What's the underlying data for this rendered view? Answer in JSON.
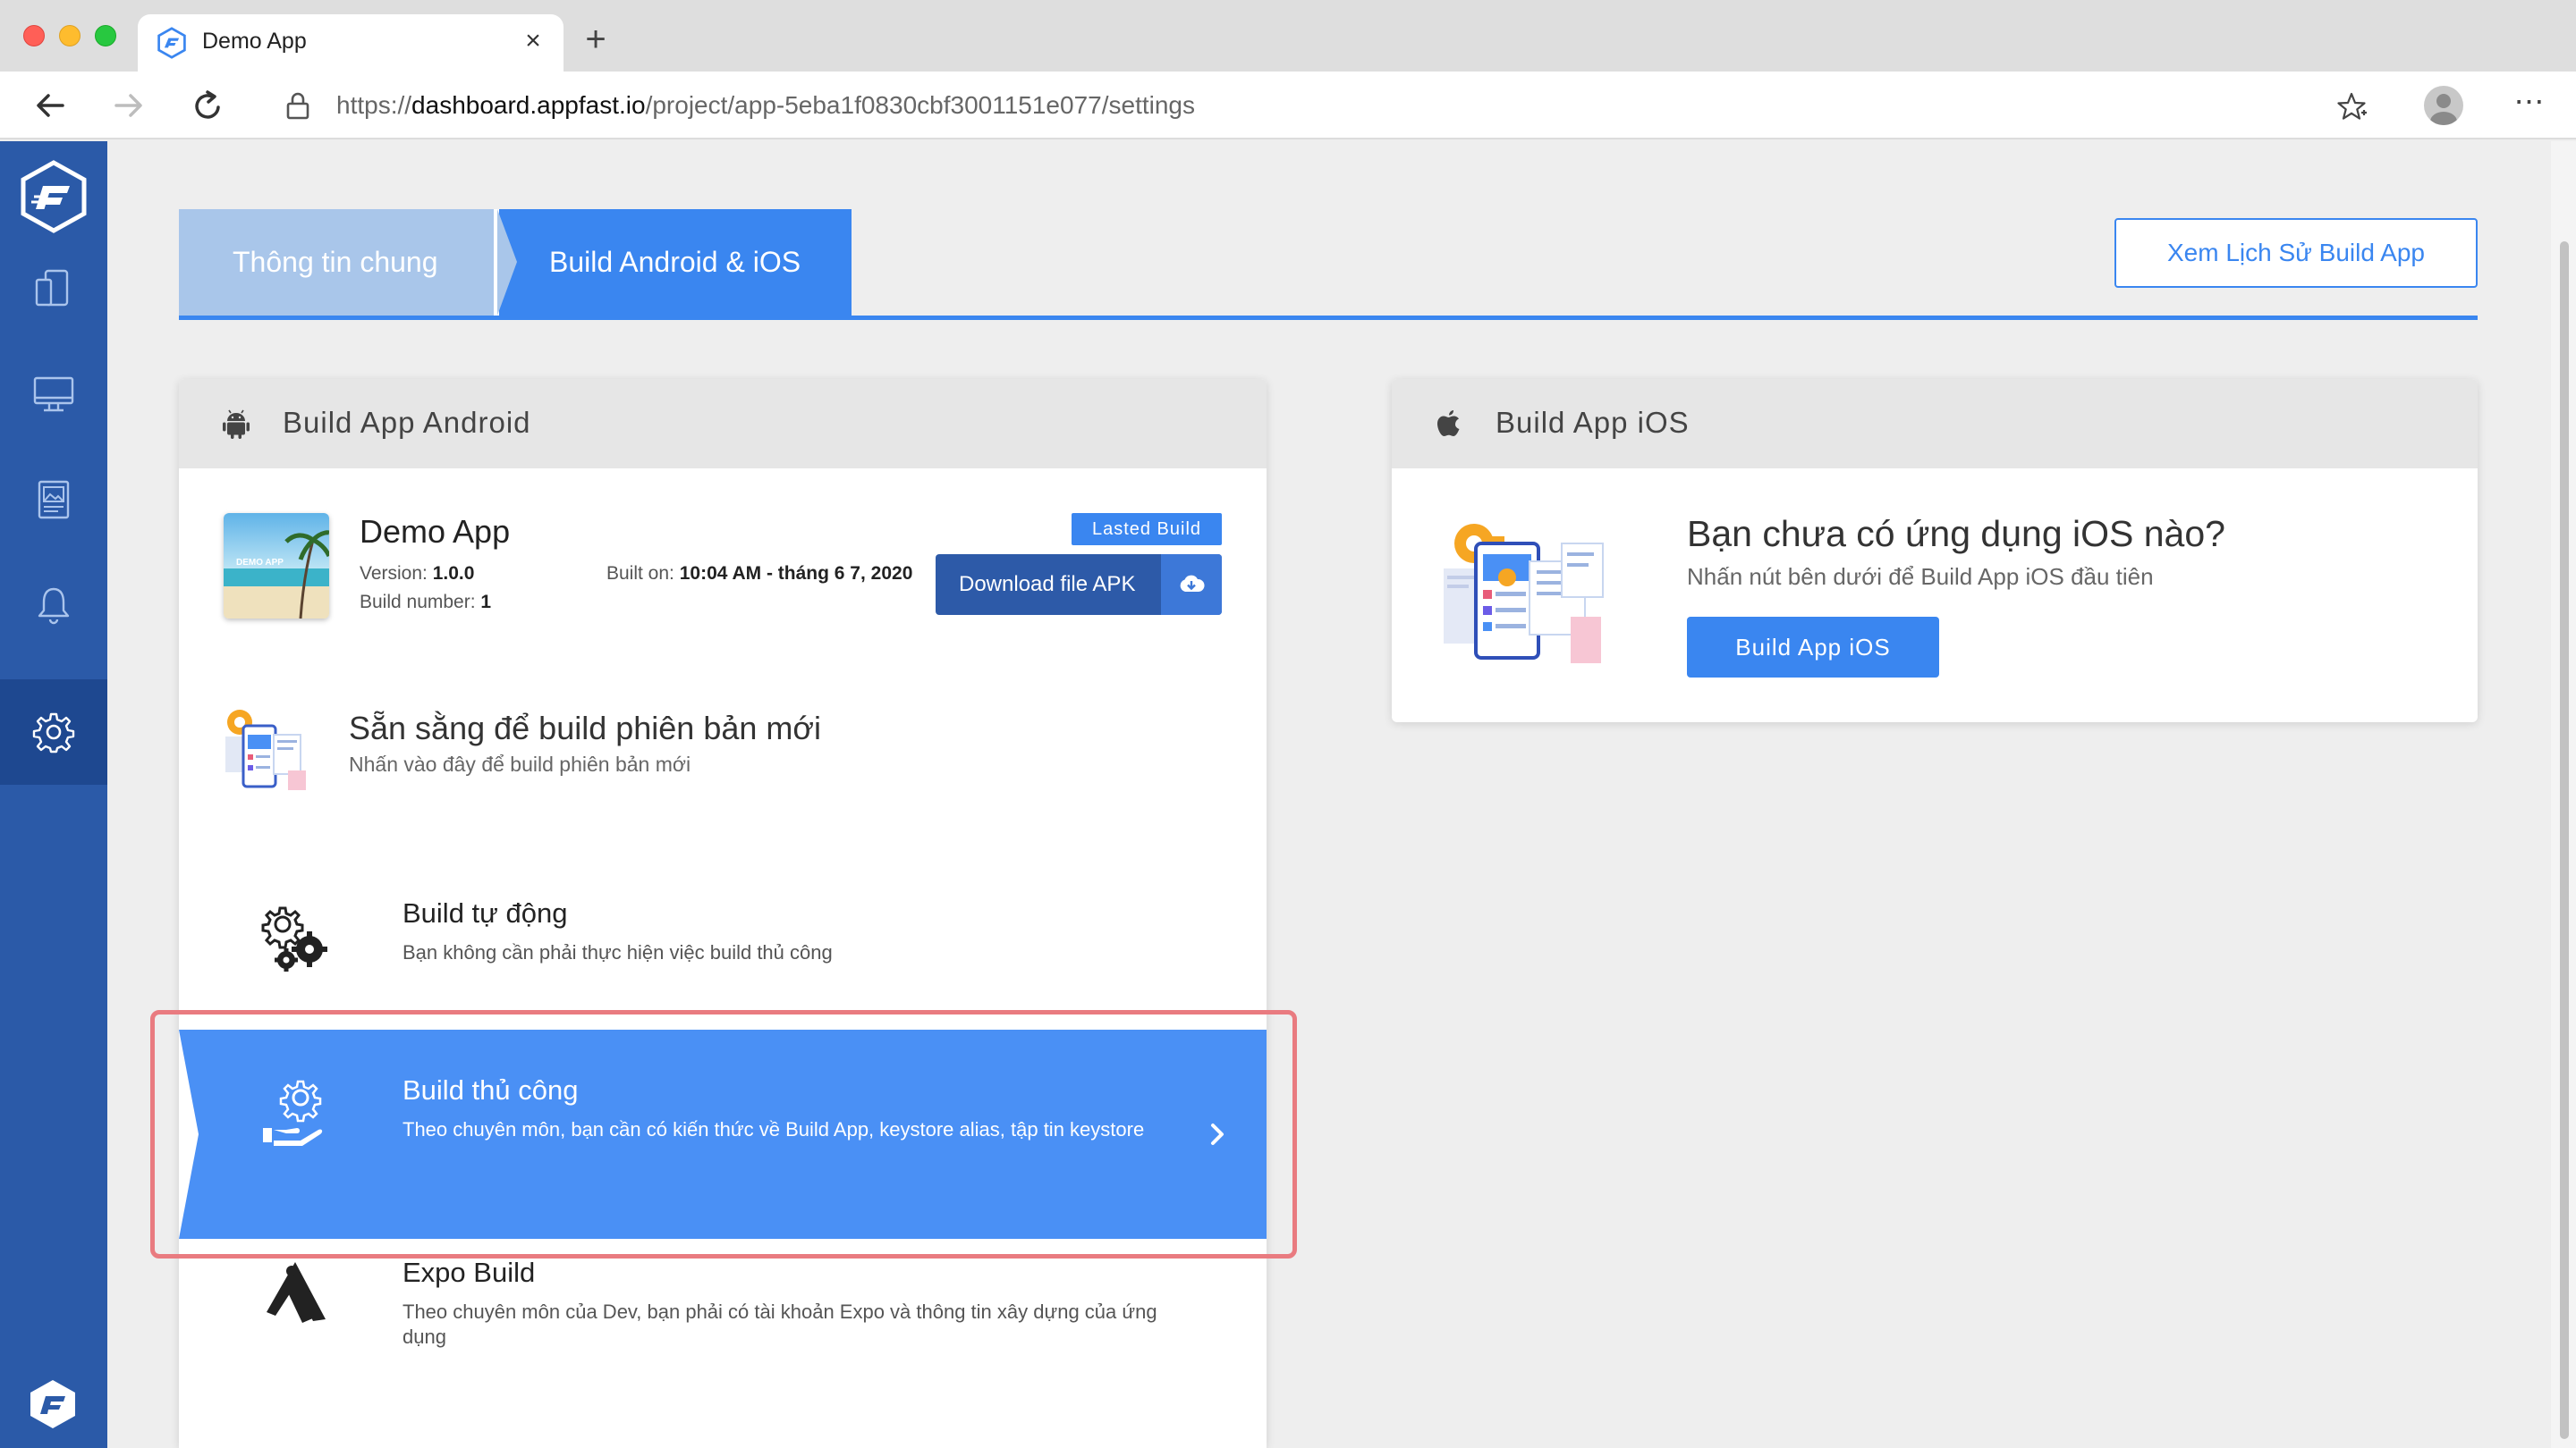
{
  "browser": {
    "tab_title": "Demo App",
    "tab_close": "×",
    "new_tab": "+",
    "url_prefix": "https://",
    "url_host": "dashboard.appfast.io",
    "url_path": "/project/app-5eba1f0830cbf3001151e077/settings",
    "menu": "⋯"
  },
  "sidebar": {
    "items": [
      {
        "icon": "devices-icon"
      },
      {
        "icon": "monitor-icon"
      },
      {
        "icon": "gallery-icon"
      },
      {
        "icon": "bell-icon"
      },
      {
        "icon": "gear-icon",
        "active": true
      }
    ]
  },
  "steps": {
    "tab1": "Thông tin chung",
    "tab2": "Build Android & iOS"
  },
  "history_button": "Xem Lịch Sử Build App",
  "android": {
    "header": "Build App Android",
    "app_name": "Demo App",
    "thumb_text": "DEMO APP",
    "version_label": "Version: ",
    "version": "1.0.0",
    "build_label": "Build number: ",
    "build_number": "1",
    "built_on_label": "Built on: ",
    "built_on": "10:04 AM - tháng 6 7, 2020",
    "badge": "Lasted Build",
    "download": "Download file APK",
    "ready_title": "Sẵn sằng để build phiên bản mới",
    "ready_sub": "Nhấn vào đây để build phiên bản mới",
    "options": [
      {
        "title": "Build tự động",
        "desc": "Bạn không cần phải thực hiện việc build thủ công"
      },
      {
        "title": "Build thủ công",
        "desc": "Theo chuyên môn, bạn cần có kiến thức về Build App, keystore alias, tập tin keystore",
        "selected": true
      },
      {
        "title": "Expo Build",
        "desc": "Theo chuyên môn của Dev, bạn phải có tài khoản Expo và thông tin xây dựng của ứng dụng"
      }
    ]
  },
  "ios": {
    "header": "Build App iOS",
    "title": "Bạn chưa có ứng dụng iOS nào?",
    "subtitle": "Nhấn nút bên dưới để Build App iOS đầu tiên",
    "button": "Build App iOS"
  },
  "colors": {
    "sidebar": "#2b5aa8",
    "accent": "#3a86f0",
    "selected_option": "#4a90f5",
    "highlight": "#e97b80"
  }
}
